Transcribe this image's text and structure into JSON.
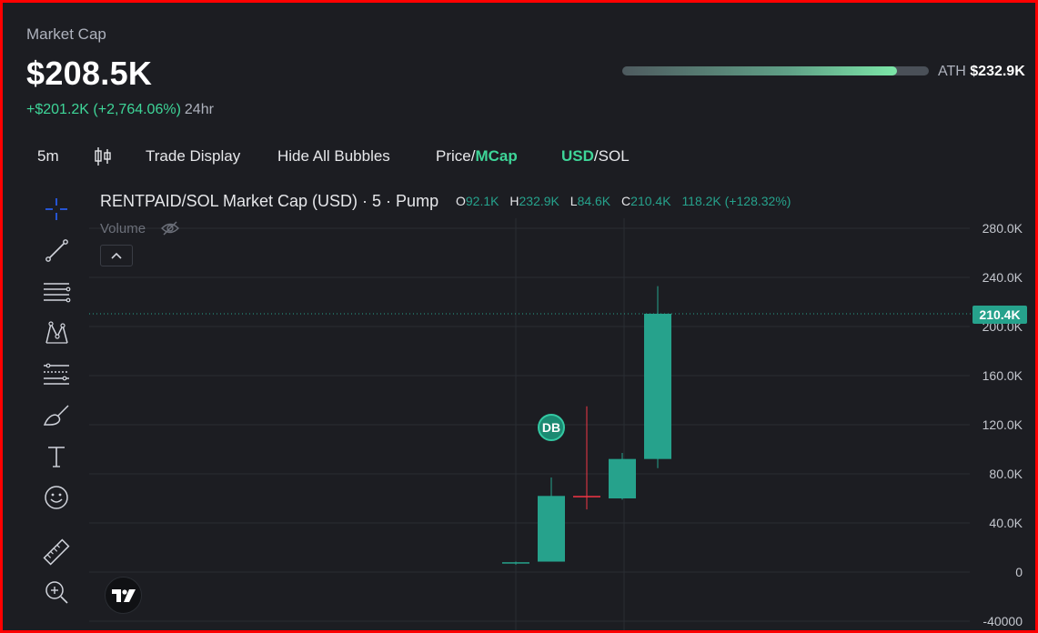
{
  "header": {
    "label": "Market Cap",
    "value": "$208.5K",
    "change": "+$201.2K (+2,764.06%)",
    "change_period": "24hr",
    "ath_label": "ATH",
    "ath_value": "$232.9K",
    "ath_progress": 0.895
  },
  "toolbar": {
    "interval": "5m",
    "trade_display": "Trade Display",
    "hide_bubbles": "Hide All Bubbles",
    "price_label": "Price",
    "sep": "/",
    "mcap_label": "MCap",
    "usd_label": "USD",
    "sol_label": "SOL"
  },
  "legend": {
    "title": "RENTPAID/SOL Market Cap (USD) · 5 · Pump",
    "o_key": "O",
    "o_val": "92.1K",
    "h_key": "H",
    "h_val": "232.9K",
    "l_key": "L",
    "l_val": "84.6K",
    "c_key": "C",
    "c_val": "210.4K",
    "change": "118.2K (+128.32%)",
    "volume": "Volume"
  },
  "bubble": {
    "label": "DB"
  },
  "price_tag": "210.4K",
  "colors": {
    "up": "#26a28c",
    "down": "#f23645",
    "accent": "#3ed598",
    "background": "#1c1d22",
    "grid": "#2a2d33"
  },
  "icons": [
    "crosshair-icon",
    "trend-line-icon",
    "horizontal-lines-icon",
    "pattern-icon",
    "fib-icon",
    "brush-icon",
    "text-icon",
    "emoji-icon",
    "ruler-icon",
    "zoom-in-icon",
    "candles-icon",
    "eye-off-icon",
    "chevron-up-icon",
    "tradingview-logo"
  ],
  "chart_data": {
    "type": "candlestick",
    "ylim": [
      -40000,
      280000
    ],
    "y_ticks": [
      -40000,
      0,
      40000,
      80000,
      120000,
      160000,
      200000,
      240000,
      280000
    ],
    "y_tick_labels": [
      "-40000",
      "0",
      "40.0K",
      "80.0K",
      "120.0K",
      "160.0K",
      "200.0K",
      "240.0K",
      "280.0K"
    ],
    "current_price": 210400,
    "candles": [
      {
        "o": 7000,
        "h": 8500,
        "l": 6000,
        "c": 8000
      },
      {
        "o": 8500,
        "h": 77000,
        "l": 8500,
        "c": 62000
      },
      {
        "o": 62000,
        "h": 135000,
        "l": 51000,
        "c": 61000
      },
      {
        "o": 60000,
        "h": 97000,
        "l": 59000,
        "c": 92100
      },
      {
        "o": 92100,
        "h": 232900,
        "l": 84600,
        "c": 210400
      }
    ]
  }
}
